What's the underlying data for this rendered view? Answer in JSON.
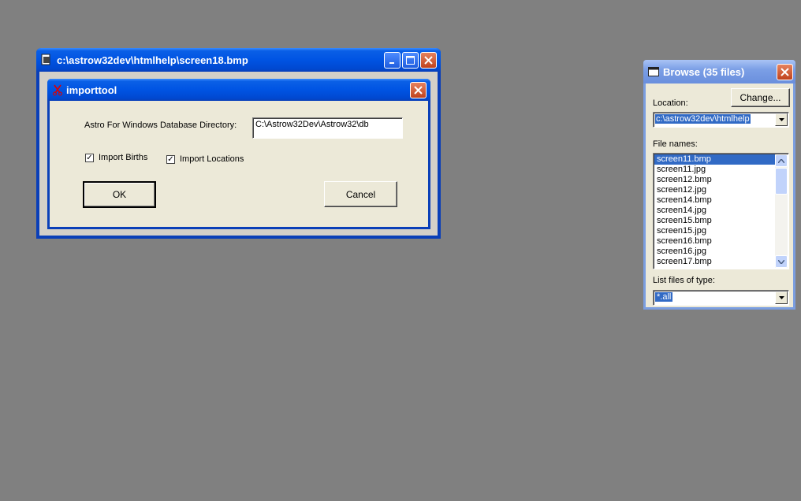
{
  "image_window": {
    "title": "c:\\astrow32dev\\htmlhelp\\screen18.bmp"
  },
  "dialog": {
    "title": "importtool",
    "dir_label": "Astro For Windows Database Directory:",
    "dir_value": "C:\\Astrow32Dev\\Astrow32\\db",
    "import_births_label": "Import Births",
    "import_births_checked": true,
    "import_locations_label": "Import Locations",
    "import_locations_checked": true,
    "ok_label": "OK",
    "cancel_label": "Cancel"
  },
  "browse": {
    "title": "Browse (35 files)",
    "location_label": "Location:",
    "change_label": "Change...",
    "location_value": "c:\\astrow32dev\\htmlhelp",
    "filenames_label": "File names:",
    "files": [
      "screen11.bmp",
      "screen11.jpg",
      "screen12.bmp",
      "screen12.jpg",
      "screen14.bmp",
      "screen14.jpg",
      "screen15.bmp",
      "screen15.jpg",
      "screen16.bmp",
      "screen16.jpg",
      "screen17.bmp"
    ],
    "selected_file": "screen11.bmp",
    "filetype_label": "List files of type:",
    "filetype_value": "*.all"
  }
}
